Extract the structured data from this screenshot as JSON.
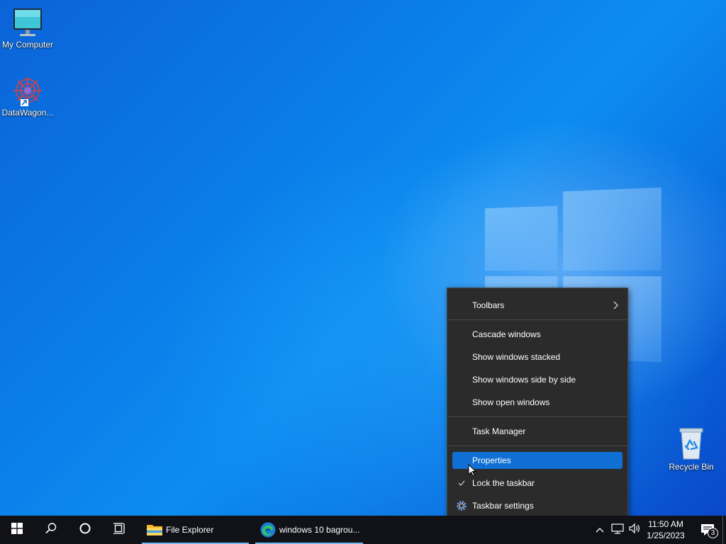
{
  "desktop": {
    "icons": [
      {
        "label": "My Computer",
        "icon": "computer-icon"
      },
      {
        "label": "DataWagon...",
        "icon": "datawagon-app-icon"
      },
      {
        "label": "Recycle Bin",
        "icon": "recycle-bin-icon"
      }
    ]
  },
  "context_menu": {
    "items": [
      {
        "label": "Toolbars",
        "submenu": true
      },
      {
        "label": "Cascade windows"
      },
      {
        "label": "Show windows stacked"
      },
      {
        "label": "Show windows side by side"
      },
      {
        "label": "Show open windows"
      },
      {
        "label": "Task Manager"
      },
      {
        "label": "Properties",
        "highlighted": true
      },
      {
        "label": "Lock the taskbar",
        "checked": true
      },
      {
        "label": "Taskbar settings",
        "icon": "gear-icon"
      }
    ]
  },
  "taskbar": {
    "apps": [
      {
        "label": "File Explorer",
        "icon": "folder-icon"
      },
      {
        "label": "windows 10 bagrou...",
        "icon": "edge-icon"
      }
    ],
    "clock": {
      "time": "11:50 AM",
      "date": "1/25/2023"
    },
    "notification_count": "3"
  },
  "colors": {
    "accent": "#0f6fd2",
    "taskbar": "#101217",
    "menu_bg": "#2b2b2b"
  }
}
